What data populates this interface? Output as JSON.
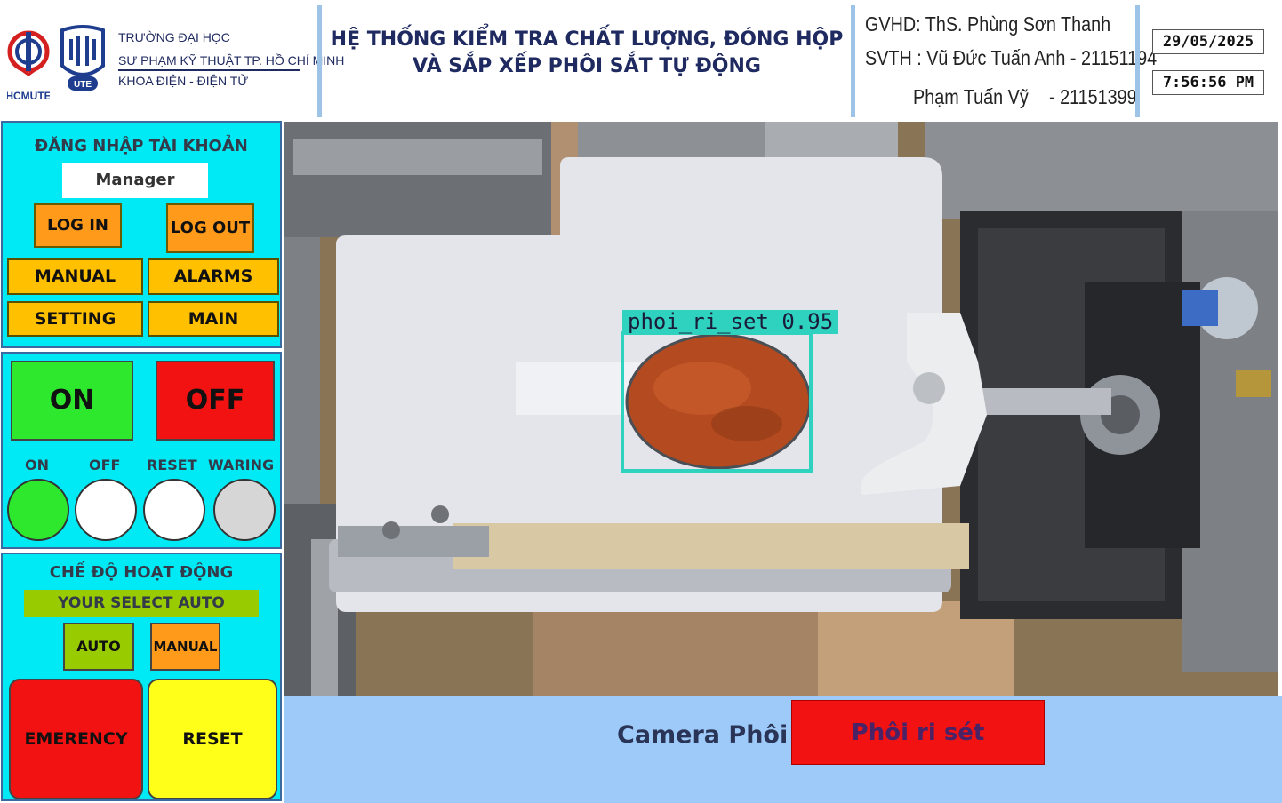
{
  "header": {
    "logo_left_text": "HCMUTE",
    "logo_right_text": "UTE",
    "school_line1": "TRƯỜNG ĐẠI HỌC",
    "school_line2": "SƯ PHẠM KỸ THUẬT TP. HỒ CHÍ MINH",
    "school_line3": "KHOA ĐIỆN - ĐIỆN TỬ",
    "title_line1": "HỆ THỐNG KIỂM TRA CHẤT LƯỢNG, ĐÓNG HỘP",
    "title_line2": "VÀ SẮP XẾP PHÔI SẮT TỰ ĐỘNG",
    "gvhd": "GVHD: ThS. Phùng Sơn Thanh",
    "svth1": "SVTH : Vũ Đức Tuấn Anh - 21151194",
    "svth2_name": "Phạm Tuấn Vỹ",
    "svth2_id": "- 21151399",
    "date": "29/05/2025",
    "time": "7:56:56 PM"
  },
  "login_panel": {
    "title": "ĐĂNG NHẬP TÀI KHOẢN",
    "user": "Manager",
    "login_label": "LOG IN",
    "logout_label": "LOG OUT",
    "manual_label": "MANUAL",
    "alarms_label": "ALARMS",
    "setting_label": "SETTING",
    "main_label": "MAIN"
  },
  "power_panel": {
    "on_label": "ON",
    "off_label": "OFF",
    "lamps": [
      {
        "label": "ON",
        "state": "active",
        "color": "#2ee82e"
      },
      {
        "label": "OFF",
        "state": "inactive",
        "color": "#ffffff"
      },
      {
        "label": "RESET",
        "state": "inactive",
        "color": "#ffffff"
      },
      {
        "label": "WARING",
        "state": "inactive",
        "color": "#d6d6d6"
      }
    ]
  },
  "mode_panel": {
    "title": "CHẾ ĐỘ HOẠT ĐỘNG",
    "selected_text": "YOUR SELECT AUTO",
    "auto_label": "AUTO",
    "manual_label": "MANUAL",
    "emergency_label": "EMERENCY",
    "reset_label": "RESET"
  },
  "camera": {
    "detection_label": "phoi_ri_set 0.95",
    "box_color": "#2fd1bf"
  },
  "bottom": {
    "camera_label": "Camera Phôi",
    "result": "Phôi ri sét"
  },
  "colors": {
    "panel_bg": "#00eaf5",
    "header_sep": "#9dc3e6",
    "bottom_bg": "#9dcaf8",
    "result_bg": "#f21212"
  }
}
